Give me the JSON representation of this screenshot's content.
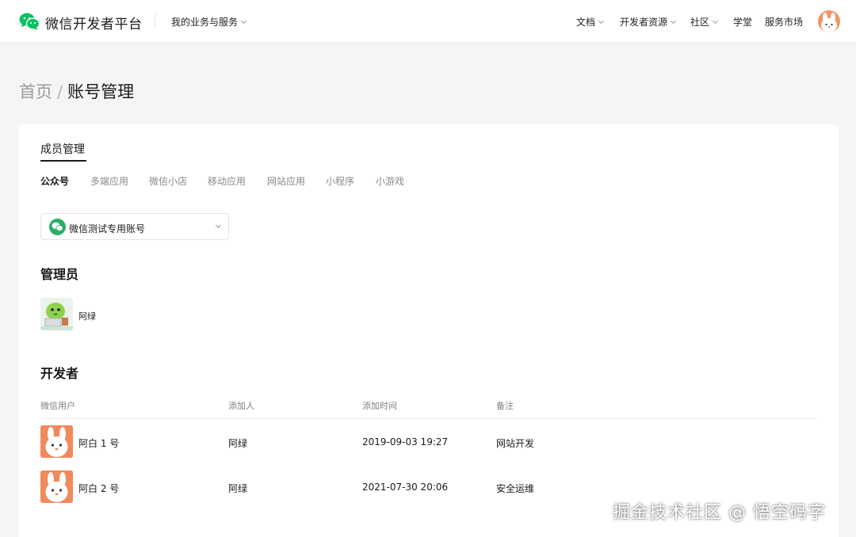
{
  "header": {
    "brand": "微信开发者平台",
    "main_menu": "我的业务与服务",
    "nav": {
      "docs": "文档",
      "resources": "开发者资源",
      "community": "社区",
      "academy": "学堂",
      "market": "服务市场"
    }
  },
  "breadcrumb": {
    "home": "首页",
    "separator": "/",
    "current": "账号管理"
  },
  "card": {
    "title": "成员管理",
    "tabs": [
      "公众号",
      "多端应用",
      "微信小店",
      "移动应用",
      "网站应用",
      "小程序",
      "小游戏"
    ],
    "active_tab": "公众号",
    "account_select": "微信测试专用账号"
  },
  "admins": {
    "heading": "管理员",
    "items": [
      {
        "name": "阿绿"
      }
    ]
  },
  "developers": {
    "heading": "开发者",
    "columns": [
      "微信用户",
      "添加人",
      "添加时间",
      "备注"
    ],
    "rows": [
      {
        "user": "阿白 1 号",
        "added_by": "阿绿",
        "time": "2019-09-03 19:27",
        "note": "网站开发"
      },
      {
        "user": "阿白 2 号",
        "added_by": "阿绿",
        "time": "2021-07-30 20:06",
        "note": "安全运维"
      }
    ]
  },
  "watermark": "掘金技术社区 @ 悟空码字",
  "colors": {
    "wechat_green": "#07c160",
    "account_icon_green": "#2aae67",
    "page_background": "#f5f5f5",
    "avatar_orange": "#f08a5d"
  }
}
